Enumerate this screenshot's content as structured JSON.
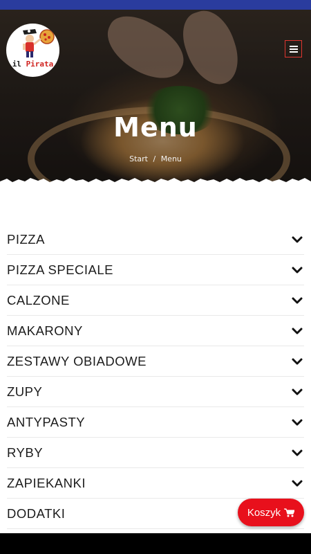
{
  "brand": {
    "name_part1": "il",
    "name_part2": "Pirata",
    "logo_icon": "pirate-with-pizza-icon",
    "accent_color": "#e8101c",
    "status_bar_color": "#2a3c9e"
  },
  "header": {
    "menu_icon": "hamburger-icon",
    "title": "Menu",
    "breadcrumb": {
      "home": "Start",
      "separator": "/",
      "current": "Menu"
    }
  },
  "menu": {
    "categories": [
      {
        "label": "PIZZA"
      },
      {
        "label": "PIZZA SPECIALE"
      },
      {
        "label": "CALZONE"
      },
      {
        "label": "MAKARONY"
      },
      {
        "label": "ZESTAWY OBIADOWE"
      },
      {
        "label": "ZUPY"
      },
      {
        "label": "ANTYPASTY"
      },
      {
        "label": "RYBY"
      },
      {
        "label": "ZAPIEKANKI"
      },
      {
        "label": "DODATKI"
      }
    ],
    "expand_icon": "chevron-down-icon"
  },
  "cart": {
    "label": "Koszyk",
    "icon": "shopping-cart-icon"
  }
}
